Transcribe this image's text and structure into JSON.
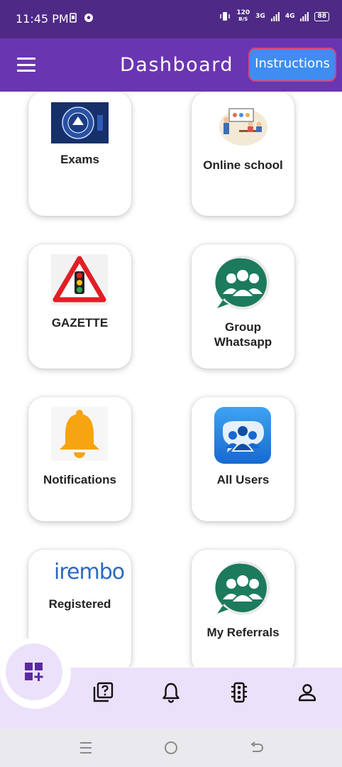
{
  "status_bar": {
    "time": "11:45 PM",
    "network_speed": "120",
    "network_speed_unit": "B/S",
    "net_1": "3G",
    "net_2": "4G",
    "battery": "88"
  },
  "app_bar": {
    "title": "Dashboard",
    "instructions_label": "Instructions",
    "menu_icon": "hamburger-menu-icon"
  },
  "cards": [
    {
      "label": "Exams",
      "icon": "exam-logo-image"
    },
    {
      "label": "Online school",
      "icon": "classroom-illustration"
    },
    {
      "label": "GAZETTE",
      "icon": "traffic-light-warning-sign"
    },
    {
      "label": "Group Whatsapp",
      "icon": "group-users-chat-icon"
    },
    {
      "label": "Notifications",
      "icon": "bell-icon"
    },
    {
      "label": "All Users",
      "icon": "users-chat-icon"
    },
    {
      "label": "Registered",
      "icon": "irembo-logo",
      "logo_text": "irembo"
    },
    {
      "label": "My Referrals",
      "icon": "group-users-chat-icon"
    }
  ],
  "bottom_nav": {
    "fab_icon": "dashboard-add-icon",
    "items": [
      "quiz-icon",
      "bell-icon",
      "traffic-light-icon",
      "profile-icon"
    ]
  },
  "colors": {
    "status_bar": "#4e2a86",
    "app_bar": "#6a35b1",
    "instructions_button": "#3f8df1",
    "bottom_nav": "#ece1fa",
    "accent": "#6a35b1"
  }
}
